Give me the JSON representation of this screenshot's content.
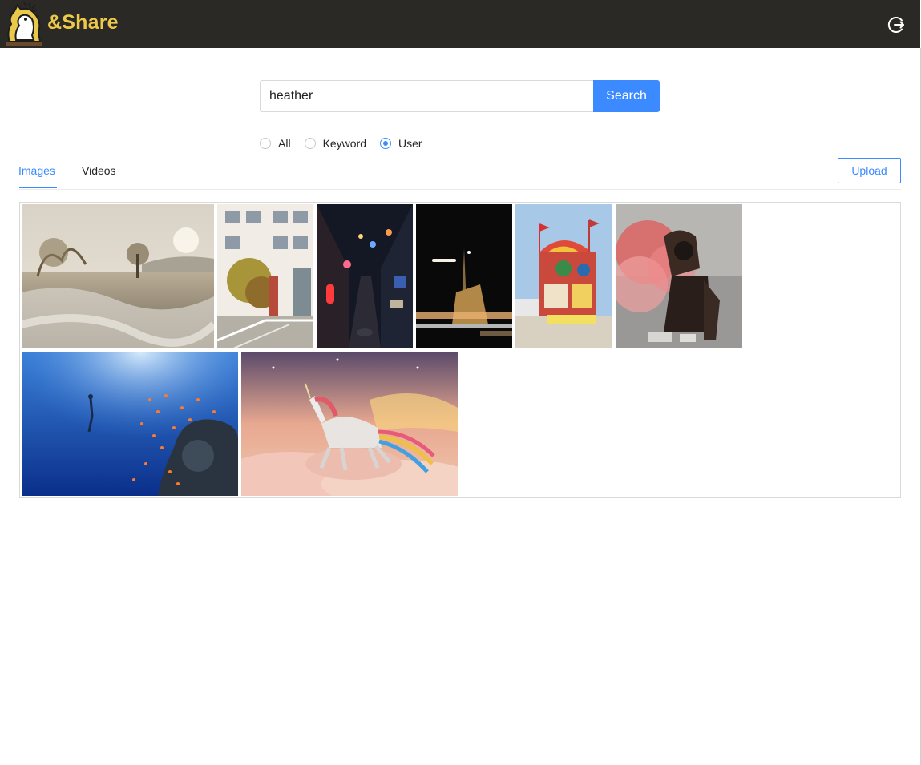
{
  "header": {
    "brand": "&Share"
  },
  "search": {
    "value": "heather",
    "button_label": "Search"
  },
  "filters": {
    "options": [
      "All",
      "Keyword",
      "User"
    ],
    "selected": "User"
  },
  "tabs": [
    {
      "label": "Images",
      "active": true
    },
    {
      "label": "Videos",
      "active": false
    }
  ],
  "upload_label": "Upload",
  "gallery": {
    "images": [
      {
        "subject": "frosty-heath-landscape"
      },
      {
        "subject": "street-building"
      },
      {
        "subject": "neon-alley-at-night"
      },
      {
        "subject": "night-city-lights"
      },
      {
        "subject": "colorful-food-cart"
      },
      {
        "subject": "red-smoke-hooded-figure"
      },
      {
        "subject": "underwater-diver-reef"
      },
      {
        "subject": "unicorn-in-clouds"
      }
    ]
  },
  "colors": {
    "accent": "#3c8aff",
    "header_bg": "#2b2925",
    "brand": "#ecc94a"
  }
}
